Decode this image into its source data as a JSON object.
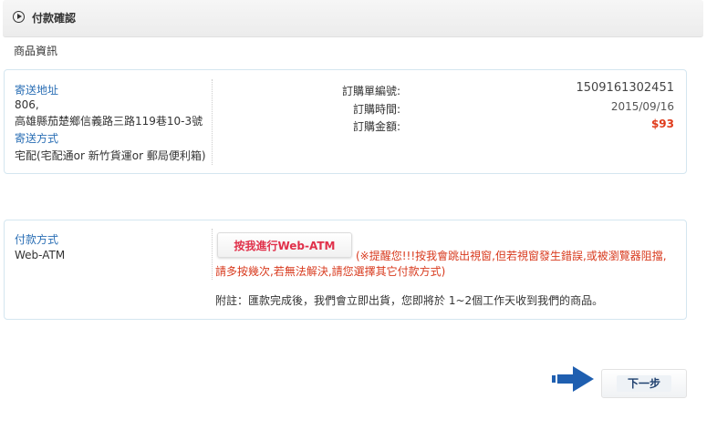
{
  "header": {
    "title": "付款確認"
  },
  "section_caption": "商品資訊",
  "shipping": {
    "address_label": "寄送地址",
    "postal_code": "806,",
    "address": "高雄縣茄楚鄉信義路三路119巷10-3號",
    "method_label": "寄送方式",
    "method": "宅配(宅配通or 新竹貨運or 郵局便利箱)"
  },
  "order": {
    "number_label": "訂購單編號:",
    "number": "1509161302451",
    "date_label": "訂購時間:",
    "date": "2015/09/16",
    "total_label": "訂購金額:",
    "total": "$93"
  },
  "payment": {
    "method_label": "付款方式",
    "method": "Web-ATM",
    "atm_button_label": "按我進行Web-ATM",
    "warning": "(※提醒您!!!按我會跳出視窗,但若視窗發生錯誤,或被瀏覽器阻擋,請多按幾次,若無法解決,請您選擇其它付款方式)",
    "note": "附註：匯款完成後，我們會立即出貨，您即將於 1~2個工作天收到我們的商品。"
  },
  "actions": {
    "next_label": "下一步"
  },
  "colors": {
    "link_blue": "#2b6fb5",
    "warning_red": "#d83a1e",
    "total_red": "#e03c1c",
    "arrow_blue": "#1f5fb0"
  },
  "icons": {
    "header": "play-circle-icon",
    "next_pointer": "arrow-right-icon"
  }
}
